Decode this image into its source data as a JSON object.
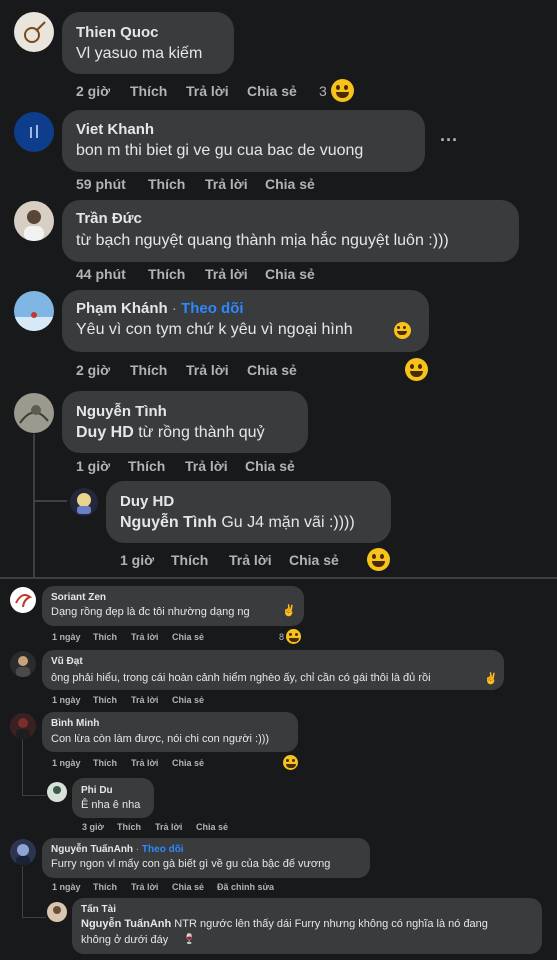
{
  "colors": {
    "background": "#18191a",
    "bubble": "#3a3b3c",
    "text": "#e4e6eb",
    "meta": "#b0b3b8",
    "link": "#2d88ff",
    "emoji": "#f7c21a"
  },
  "actions": {
    "like": "Thích",
    "reply": "Trả lời",
    "share": "Chia sẻ",
    "edited": "Đã chỉnh sửa",
    "follow": "Theo dõi"
  },
  "top": [
    {
      "name": "Thien Quoc",
      "text": "Vl yasuo ma kiếm",
      "time": "2 giờ",
      "reactions": "3"
    },
    {
      "name": "Viet Khanh",
      "text": "bon m thi biet gi ve gu cua bac de vuong",
      "time": "59 phút",
      "more": "···"
    },
    {
      "name": "Trần Đức",
      "text": "từ bạch nguyệt quang thành mịa hắc nguyệt luôn :)))",
      "time": "44 phút"
    },
    {
      "name": "Phạm Khánh",
      "text": "Yêu vì con tym chứ k yêu vì ngoại hình",
      "time": "2 giờ"
    },
    {
      "name": "Nguyễn Tình",
      "mention": "Duy HD",
      "text": " từ rồng thành quỷ",
      "time": "1 giờ"
    },
    {
      "name": "Duy HD",
      "mention": "Nguyễn Tình",
      "text": " Gu J4 mặn vãi :))))",
      "time": "1 giờ"
    }
  ],
  "bottom": [
    {
      "name": "Soriant Zen",
      "text": "Dạng rồng đẹp là đc tôi nhường dạng ng",
      "time": "1 ngày",
      "reactions": "8"
    },
    {
      "name": "Vũ Đạt",
      "text": "ông phải hiểu, trong cái hoàn cảnh hiểm nghèo ấy, chỉ cần có gái thôi là đủ rồi",
      "time": "1 ngày"
    },
    {
      "name": "Bình Minh",
      "text": "Con lừa còn làm được, nói chi con người :)))",
      "time": "1 ngày"
    },
    {
      "name": "Phi Du",
      "text": "Ê nha ê nha",
      "time": "3 giờ"
    },
    {
      "name": "Nguyễn TuấnAnh",
      "text": "Furry ngon vl mấy con gà biết gì về gu của bậc đế vương",
      "time": "1 ngày"
    },
    {
      "name": "Tấn Tài",
      "mention": "Nguyễn TuấnAnh",
      "text": " NTR ngước lên thấy dái Furry nhưng không có nghĩa là nó đang",
      "text2": "không ở dưới đáy"
    }
  ]
}
